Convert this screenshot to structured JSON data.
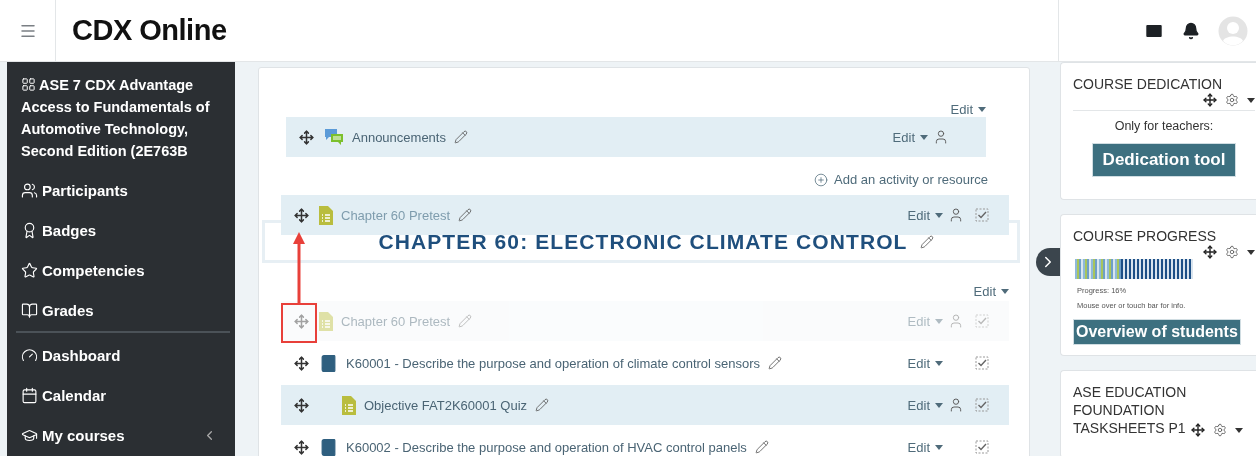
{
  "header": {
    "logo": "CDX Online"
  },
  "sidebar": {
    "course_title": "ASE 7 CDX Advantage Access to Fundamentals of Automotive Technology, Second Edition (2E763B",
    "groups": [
      {
        "items": [
          {
            "kind": "participants",
            "label": "Participants",
            "expandable": false
          },
          {
            "kind": "badges",
            "label": "Badges",
            "expandable": false
          },
          {
            "kind": "competencies",
            "label": "Competencies",
            "expandable": false
          },
          {
            "kind": "grades",
            "label": "Grades",
            "expandable": false
          }
        ]
      },
      {
        "items": [
          {
            "kind": "dashboard",
            "label": "Dashboard",
            "expandable": false
          },
          {
            "kind": "calendar",
            "label": "Calendar",
            "expandable": false
          },
          {
            "kind": "courses",
            "label": "My courses",
            "expandable": true
          }
        ]
      }
    ]
  },
  "main": {
    "top_section": {
      "edit": "Edit",
      "activities": [
        {
          "kind": "forum",
          "name": "Announcements",
          "edit": "Edit",
          "person_icon": true,
          "completion_icon": false,
          "highlighted": true,
          "ghost": false,
          "indented": false
        }
      ],
      "add_activity": "Add an activity or resource"
    },
    "dragged_activity": {
      "kind": "quiz",
      "name": "Chapter 60 Pretest",
      "edit": "Edit",
      "person_icon": true,
      "completion_icon": true
    },
    "section": {
      "title": "CHAPTER 60: ELECTRONIC CLIMATE CONTROL",
      "edit": "Edit",
      "activities": [
        {
          "kind": "quiz",
          "name": "Chapter 60 Pretest",
          "edit": "Edit",
          "person_icon": true,
          "completion_icon": true,
          "highlighted": false,
          "ghost": true,
          "indented": false
        },
        {
          "kind": "book",
          "name": "K60001 - Describe the purpose and operation of climate control sensors",
          "edit": "Edit",
          "person_icon": false,
          "completion_icon": true,
          "highlighted": false,
          "ghost": false,
          "indented": false
        },
        {
          "kind": "quiz",
          "name": "Objective FAT2K60001 Quiz",
          "edit": "Edit",
          "person_icon": true,
          "completion_icon": true,
          "highlighted": true,
          "ghost": false,
          "indented": true
        },
        {
          "kind": "book",
          "name": "K60002 - Describe the purpose and operation of HVAC control panels",
          "edit": "Edit",
          "person_icon": false,
          "completion_icon": true,
          "highlighted": false,
          "ghost": false,
          "indented": false
        }
      ]
    }
  },
  "blocks": [
    {
      "kind": "dedication",
      "title": "COURSE DEDICATION",
      "note": "Only for teachers:",
      "button": "Dedication tool"
    },
    {
      "kind": "progress",
      "title": "COURSE PROGRESS",
      "progress_text": "Progress: 16%",
      "hint": "Mouse over or touch bar for info.",
      "button": "Overview of students"
    },
    {
      "kind": "plain",
      "title": "ASE EDUCATION FOUNDATION TASKSHEETS P1"
    }
  ]
}
